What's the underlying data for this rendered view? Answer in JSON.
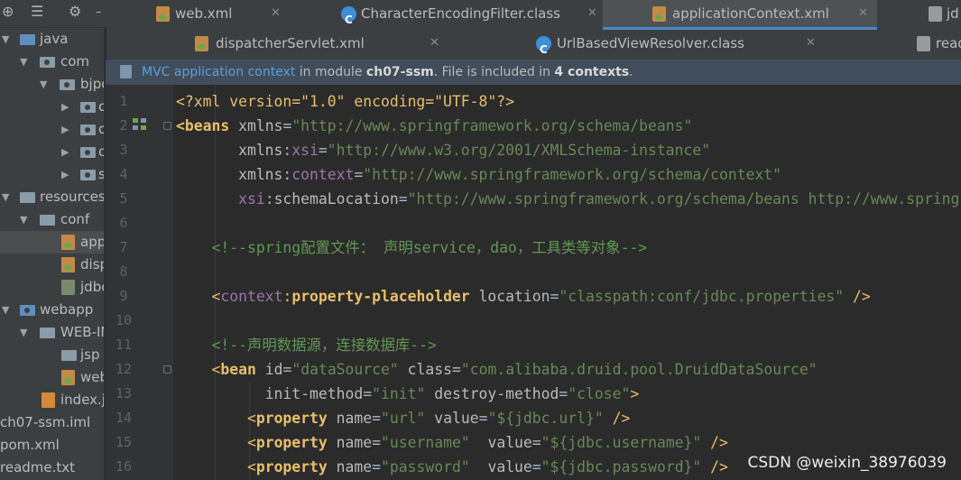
{
  "left_toolbar": {
    "icons": [
      "target-icon",
      "collapse-icon",
      "gear-icon",
      "hide-icon"
    ]
  },
  "tree": [
    {
      "label": "java",
      "type": "folder-blue",
      "expanded": true
    },
    {
      "label": "com",
      "type": "folder",
      "expanded": true
    },
    {
      "label": "bjpo",
      "type": "folder",
      "expanded": true
    },
    {
      "label": "c",
      "type": "folder-small"
    },
    {
      "label": "c",
      "type": "folder-small"
    },
    {
      "label": "c",
      "type": "folder-small"
    },
    {
      "label": "s",
      "type": "folder-small"
    },
    {
      "label": "resources",
      "type": "folder",
      "expanded": true
    },
    {
      "label": "conf",
      "type": "folder",
      "expanded": true
    },
    {
      "label": "app",
      "type": "xml",
      "selected": true
    },
    {
      "label": "disp",
      "type": "xml"
    },
    {
      "label": "jdbc",
      "type": "props"
    },
    {
      "label": "webapp",
      "type": "folder-blue",
      "expanded": true
    },
    {
      "label": "WEB-IN",
      "type": "folder",
      "expanded": true
    },
    {
      "label": "jsp",
      "type": "folder"
    },
    {
      "label": "web",
      "type": "xml"
    },
    {
      "label": "index.js",
      "type": "jsp"
    },
    {
      "label": "ch07-ssm.iml",
      "type": "file"
    },
    {
      "label": "pom.xml",
      "type": "xml"
    },
    {
      "label": "readme.txt",
      "type": "file"
    }
  ],
  "tabs_row1": [
    {
      "label": "web.xml",
      "icon": "xml-file-icon"
    },
    {
      "label": "CharacterEncodingFilter.class",
      "icon": "class-icon"
    },
    {
      "label": "applicationContext.xml",
      "icon": "xml-file-icon",
      "active": true
    },
    {
      "label": "jd",
      "icon": "file-icon"
    }
  ],
  "tabs_row2": [
    {
      "label": "dispatcherServlet.xml",
      "icon": "xml-file-icon"
    },
    {
      "label": "UrlBasedViewResolver.class",
      "icon": "class-icon"
    },
    {
      "label": "read",
      "icon": "file-icon"
    }
  ],
  "banner": {
    "link": "MVC application context",
    "text1": " in module ",
    "module": "ch07-ssm",
    "text2": ". File is included in ",
    "count": "4 contexts",
    "text3": "."
  },
  "line_numbers": [
    "1",
    "2",
    "3",
    "4",
    "5",
    "6",
    "7",
    "8",
    "9",
    "10",
    "11",
    "12",
    "13",
    "14",
    "15",
    "16"
  ],
  "code": {
    "l1_decl": "<?xml version=\"1.0\" encoding=\"UTF-8\"?>",
    "l2_tag": "<beans",
    "l2_attr": "xmlns",
    "l2_val": "\"http://www.springframework.org/schema/beans\"",
    "l3_ns": "xmlns",
    "l3_attr": "xsi",
    "l3_val": "\"http://www.w3.org/2001/XMLSchema-instance\"",
    "l4_ns": "xmlns",
    "l4_attr": "context",
    "l4_val": "\"http://www.springframework.org/schema/context\"",
    "l5_ns": "xsi",
    "l5_attr": "schemaLocation",
    "l5_val": "\"http://www.springframework.org/schema/beans http://www.spring",
    "l7_comment": "<!--spring配置文件： 声明service，dao，工具类等对象-->",
    "l9_ns": "context",
    "l9_tag": "property-placeholder",
    "l9_attr": "location",
    "l9_val": "\"classpath:conf/jdbc.properties\"",
    "l9_end": " />",
    "l11_comment": "<!--声明数据源，连接数据库-->",
    "l12_tag": "bean",
    "l12_a1": "id",
    "l12_v1": "\"dataSource\"",
    "l12_a2": "class",
    "l12_v2": "\"com.alibaba.druid.pool.DruidDataSource\"",
    "l13_a1": "init-method",
    "l13_v1": "\"init\"",
    "l13_a2": "destroy-method",
    "l13_v2": "\"close\"",
    "l13_end": ">",
    "l14_tag": "property",
    "l14_a1": "name",
    "l14_v1": "\"url\"",
    "l14_a2": "value",
    "l14_v2": "\"${jdbc.url}\"",
    "l14_end": " />",
    "l15_tag": "property",
    "l15_a1": "name",
    "l15_v1": "\"username\"",
    "l15_a2": "value",
    "l15_v2": "\"${jdbc.username}\"",
    "l15_end": " />",
    "l16_tag": "property",
    "l16_a1": "name",
    "l16_v1": "\"password\"",
    "l16_a2": "value",
    "l16_v2": "\"${jdbc.password}\"",
    "l16_end": " />"
  },
  "watermark": "CSDN @weixin_38976039",
  "colors": {
    "tag": "#e8bf6a",
    "string": "#6a8759",
    "comment": "#629755",
    "namespace": "#9876aa",
    "link": "#5c9fd8",
    "background": "#2b2b2b"
  }
}
